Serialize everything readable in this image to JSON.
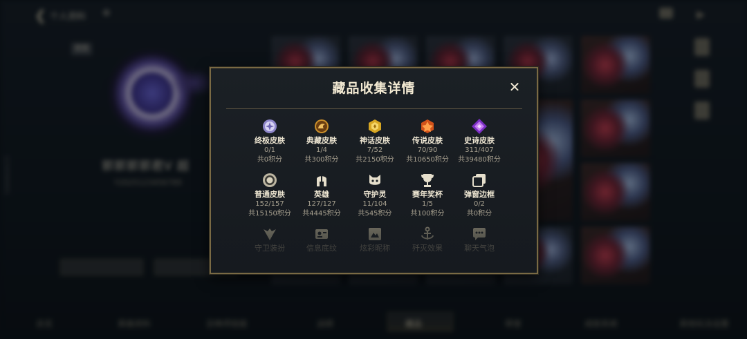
{
  "background": {
    "page_title": "个人资料",
    "player_name": "郭郭郭郭君V 超",
    "player_sub": "Y2025123456789",
    "side_id": "1234560001",
    "tag": "状态",
    "bottom_tabs": [
      "总览",
      "英雄资料",
      "召唤师技能",
      "战绩",
      "藏品",
      "荣誉",
      "成就系统",
      "其他玩法设置"
    ],
    "active_tab": "藏品"
  },
  "modal": {
    "title": "藏品收集详情",
    "close_symbol": "✕",
    "items": [
      {
        "icon": "ultimate-skin-icon",
        "name": "终极皮肤",
        "count": "0/1",
        "points": "共0积分"
      },
      {
        "icon": "treasure-skin-icon",
        "name": "典藏皮肤",
        "count": "1/4",
        "points": "共300积分"
      },
      {
        "icon": "mythic-skin-icon",
        "name": "神话皮肤",
        "count": "7/52",
        "points": "共2150积分"
      },
      {
        "icon": "legendary-skin-icon",
        "name": "传说皮肤",
        "count": "70/90",
        "points": "共10650积分"
      },
      {
        "icon": "epic-skin-icon",
        "name": "史诗皮肤",
        "count": "311/407",
        "points": "共39480积分"
      },
      {
        "icon": "normal-skin-icon",
        "name": "普通皮肤",
        "count": "152/157",
        "points": "共15150积分"
      },
      {
        "icon": "hero-helmet-icon",
        "name": "英雄",
        "count": "127/127",
        "points": "共4445积分"
      },
      {
        "icon": "guardian-spirit-icon",
        "name": "守护灵",
        "count": "11/104",
        "points": "共545积分"
      },
      {
        "icon": "season-trophy-icon",
        "name": "赛年奖杯",
        "count": "1/5",
        "points": "共100积分"
      },
      {
        "icon": "popup-frame-icon",
        "name": "弹窗边框",
        "count": "0/2",
        "points": "共0积分"
      },
      {
        "icon": "guardian-outfit-icon",
        "name": "守卫装扮",
        "count": "",
        "points": ""
      },
      {
        "icon": "info-card-icon",
        "name": "信息底纹",
        "count": "",
        "points": ""
      },
      {
        "icon": "colorful-name-icon",
        "name": "炫彩昵称",
        "count": "",
        "points": ""
      },
      {
        "icon": "kill-effect-icon",
        "name": "歼灭效果",
        "count": "",
        "points": ""
      },
      {
        "icon": "chat-bubble-icon",
        "name": "聊天气泡",
        "count": "",
        "points": ""
      }
    ]
  },
  "colors": {
    "modal_border": "#7a6a44",
    "modal_bg": "#1b2025",
    "title": "#f3ead3",
    "subtext": "#a7a08f"
  }
}
